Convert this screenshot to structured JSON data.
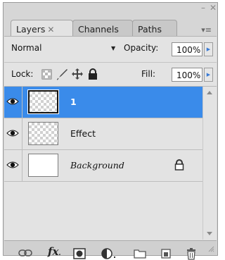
{
  "window": {
    "minimize_glyph": "–",
    "close_glyph": "✕"
  },
  "tabs": [
    {
      "label": "Layers",
      "close": "✕",
      "active": true
    },
    {
      "label": "Channels",
      "active": false
    },
    {
      "label": "Paths",
      "active": false
    }
  ],
  "panel_menu_glyph": "▾≡",
  "blend_mode": "Normal",
  "opacity_label": "Opacity:",
  "opacity_value": "100%",
  "lock_label": "Lock:",
  "fill_label": "Fill:",
  "fill_value": "100%",
  "layers": [
    {
      "name": "1",
      "selected": true,
      "transparent": true
    },
    {
      "name": "Effect",
      "selected": false,
      "transparent": true
    },
    {
      "name": "Background",
      "selected": false,
      "transparent": false,
      "locked": true
    }
  ],
  "colors": {
    "selection": "#3a8bea",
    "panel": "#e3e3e3",
    "frame": "#d6d6d6"
  },
  "icons": {
    "lock": [
      "lock-transparent-pixels-icon",
      "lock-image-pixels-icon",
      "lock-position-icon",
      "lock-all-icon"
    ],
    "bottom": [
      "link-layers-icon",
      "layer-style-fx-icon",
      "layer-mask-icon",
      "adjustment-layer-icon",
      "new-group-icon",
      "new-layer-icon",
      "delete-layer-icon"
    ]
  },
  "bottom_fx_label": "fx"
}
